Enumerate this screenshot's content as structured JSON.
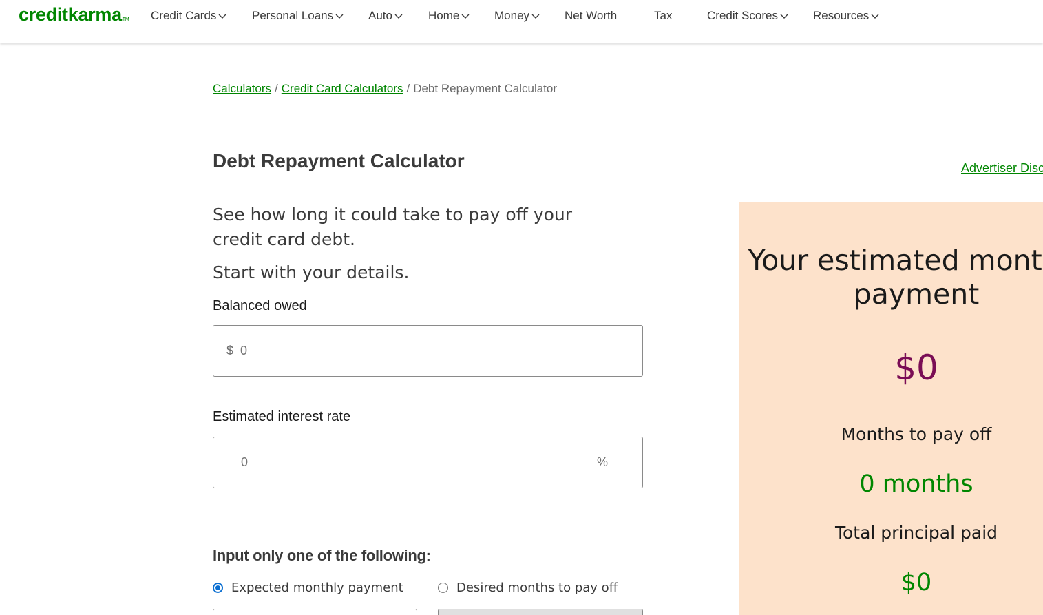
{
  "header": {
    "logo": "creditkarma",
    "logo_mark": "TM",
    "nav": [
      {
        "label": "Credit Cards",
        "dropdown": true
      },
      {
        "label": "Personal Loans",
        "dropdown": true
      },
      {
        "label": "Auto",
        "dropdown": true
      },
      {
        "label": "Home",
        "dropdown": true
      },
      {
        "label": "Money",
        "dropdown": true
      },
      {
        "label": "Net Worth",
        "dropdown": false
      },
      {
        "label": "Tax",
        "dropdown": false
      },
      {
        "label": "Credit Scores",
        "dropdown": true
      },
      {
        "label": "Resources",
        "dropdown": true
      }
    ]
  },
  "breadcrumb": {
    "items": [
      "Calculators",
      "Credit Card Calculators"
    ],
    "current": "Debt Repayment Calculator",
    "separator": "/"
  },
  "main": {
    "title": "Debt Repayment Calculator",
    "advertiser_link": "Advertiser Disclosure",
    "intro": "See how long it could take to pay off your credit card debt.",
    "intro2": "Start with your details.",
    "balance": {
      "label": "Balanced owed",
      "prefix": "$",
      "placeholder": "0"
    },
    "interest": {
      "label": "Estimated interest rate",
      "placeholder": "0",
      "suffix": "%"
    },
    "section_title": "Input only one of the following:",
    "options": [
      {
        "label": "Expected monthly payment",
        "checked": true
      },
      {
        "label": "Desired months to pay off",
        "checked": false
      }
    ]
  },
  "result": {
    "title": "Your estimated monthly payment",
    "payment": "$0",
    "months_label": "Months to pay off",
    "months_value": "0 months",
    "principal_label": "Total principal paid",
    "principal_value": "$0"
  },
  "colors": {
    "brand_green": "#008600",
    "payment_color": "#7a0d55",
    "panel_bg": "#fde2cb",
    "radio_blue": "#0a6ed1"
  }
}
